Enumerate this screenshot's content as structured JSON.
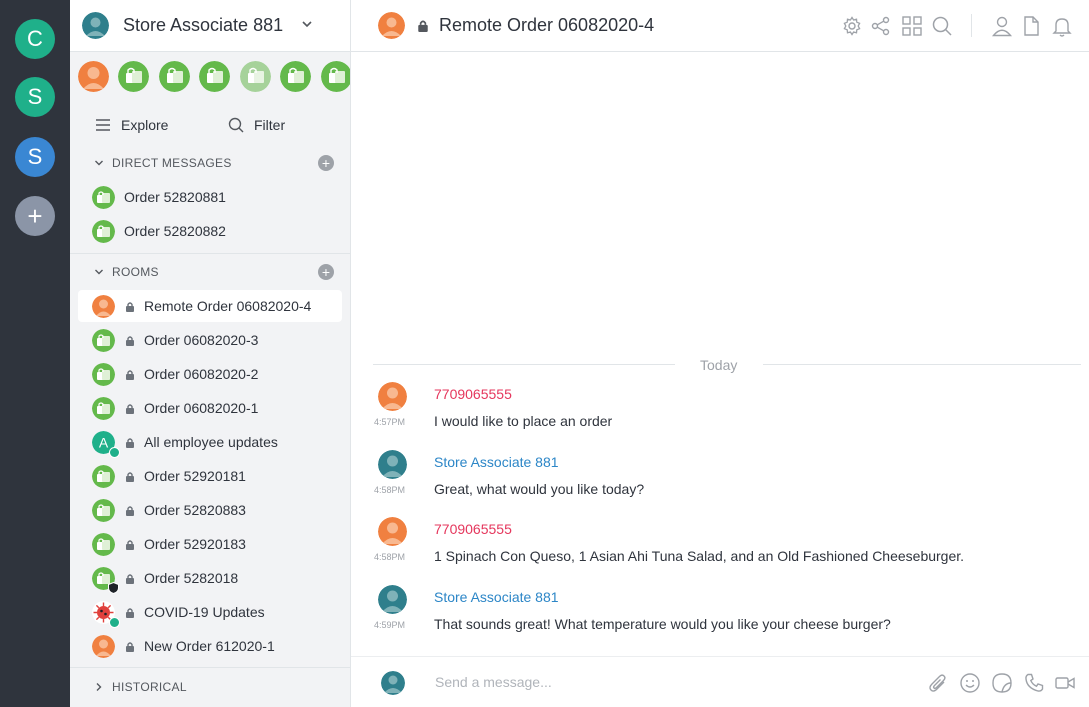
{
  "colors": {
    "rail_bg": "#2f343d",
    "accent_green": "#1fb08a",
    "accent_blue": "#3a87d3",
    "orange_avatar": "#f08040",
    "bag_green": "#64b94b",
    "customer_name": "#e5375d",
    "staff_name": "#2c86c7"
  },
  "rail": {
    "servers": [
      {
        "letter": "C",
        "color": "#1fb08a"
      },
      {
        "letter": "S",
        "color": "#1fb08a"
      },
      {
        "letter": "S",
        "color": "#3a87d3"
      }
    ],
    "add_label": "+"
  },
  "sidebar": {
    "user_title": "Store Associate 881",
    "explore_label": "Explore",
    "filter_label": "Filter",
    "direct_messages": {
      "heading": "DIRECT MESSAGES",
      "items": [
        {
          "label": "Order 52820881"
        },
        {
          "label": "Order 52820882"
        }
      ]
    },
    "rooms": {
      "heading": "ROOMS",
      "items": [
        {
          "label": "Remote Order 06082020-4",
          "avatar": "orange",
          "active": true
        },
        {
          "label": "Order 06082020-3",
          "avatar": "bag"
        },
        {
          "label": "Order 06082020-2",
          "avatar": "bag"
        },
        {
          "label": "Order 06082020-1",
          "avatar": "bag"
        },
        {
          "label": "All employee updates",
          "avatar": "letter-a",
          "avatar_letter": "A"
        },
        {
          "label": "Order 52920181",
          "avatar": "bag"
        },
        {
          "label": "Order 52820883",
          "avatar": "bag"
        },
        {
          "label": "Order 52920183",
          "avatar": "bag"
        },
        {
          "label": "Order 5282018",
          "avatar": "bag-shield"
        },
        {
          "label": "COVID-19 Updates",
          "avatar": "virus"
        },
        {
          "label": "New Order 612020-1",
          "avatar": "orange"
        }
      ]
    },
    "historical_heading": "HISTORICAL"
  },
  "main": {
    "room_title": "Remote Order 06082020-4",
    "day_separator": "Today",
    "messages": [
      {
        "user": "7709065555",
        "role": "customer",
        "time": "4:57PM",
        "text": "I would like to place an order"
      },
      {
        "user": "Store Associate 881",
        "role": "staff",
        "time": "4:58PM",
        "text": "Great, what would you like today?"
      },
      {
        "user": "7709065555",
        "role": "customer",
        "time": "4:58PM",
        "text": "1 Spinach Con Queso, 1 Asian Ahi Tuna Salad, and an Old Fashioned Cheeseburger."
      },
      {
        "user": "Store Associate 881",
        "role": "staff",
        "time": "4:59PM",
        "text": "That sounds great! What temperature would you like your cheese burger?"
      }
    ],
    "composer_placeholder": "Send a message..."
  }
}
